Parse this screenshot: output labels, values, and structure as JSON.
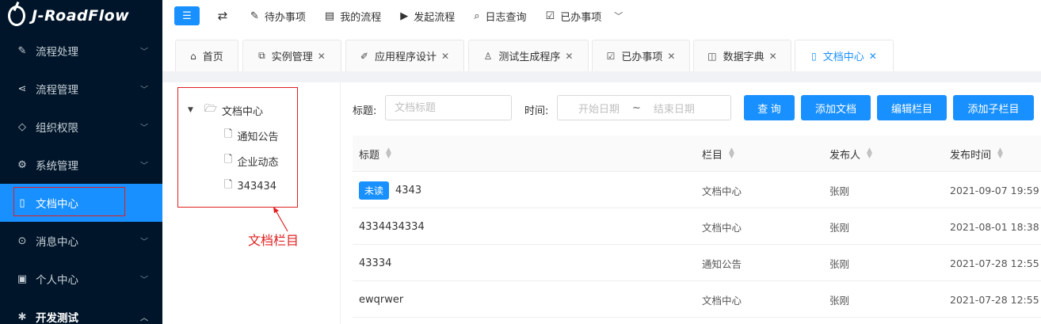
{
  "app": {
    "logo_text": "J-RoadFlow"
  },
  "sidebar": {
    "items": [
      {
        "label": "流程处理",
        "icon": "edit-icon",
        "glyph": "✎"
      },
      {
        "label": "流程管理",
        "icon": "share-icon",
        "glyph": "⋖"
      },
      {
        "label": "组织权限",
        "icon": "tag-icon",
        "glyph": "◇"
      },
      {
        "label": "系统管理",
        "icon": "gear-icon",
        "glyph": "⚙"
      },
      {
        "label": "文档中心",
        "icon": "document-icon",
        "glyph": "▯"
      },
      {
        "label": "消息中心",
        "icon": "chat-icon",
        "glyph": "⊙"
      },
      {
        "label": "个人中心",
        "icon": "id-card-icon",
        "glyph": "▣"
      },
      {
        "label": "开发测试",
        "icon": "code-icon",
        "glyph": "✱"
      }
    ]
  },
  "topbar": {
    "links": [
      {
        "label": "待办事项",
        "glyph": "✎"
      },
      {
        "label": "我的流程",
        "glyph": "▤"
      },
      {
        "label": "发起流程",
        "glyph": "▶"
      },
      {
        "label": "日志查询",
        "glyph": "⌕"
      },
      {
        "label": "已办事项",
        "glyph": "☑"
      }
    ]
  },
  "tabs": [
    {
      "label": "首页",
      "glyph": "⌂",
      "closable": false
    },
    {
      "label": "实例管理",
      "glyph": "⧉",
      "closable": true
    },
    {
      "label": "应用程序设计",
      "glyph": "✐",
      "closable": true
    },
    {
      "label": "测试生成程序",
      "glyph": "♙",
      "closable": true
    },
    {
      "label": "已办事项",
      "glyph": "☑",
      "closable": true
    },
    {
      "label": "数据字典",
      "glyph": "◫",
      "closable": true
    },
    {
      "label": "文档中心",
      "glyph": "▯",
      "closable": true
    }
  ],
  "tree": {
    "root": "文档中心",
    "children": [
      "通知公告",
      "企业动态",
      "343434"
    ]
  },
  "annotation": {
    "label": "文档栏目"
  },
  "search": {
    "title_label": "标题:",
    "title_placeholder": "文档标题",
    "time_label": "时间:",
    "start_placeholder": "开始日期",
    "range_sep": "~",
    "end_placeholder": "结束日期",
    "buttons": [
      "查 询",
      "添加文档",
      "编辑栏目",
      "添加子栏目"
    ]
  },
  "table": {
    "columns": [
      "标题",
      "栏目",
      "发布人",
      "发布时间"
    ],
    "rows": [
      {
        "badge": "未读",
        "title": "4343",
        "column": "文档中心",
        "author": "张刚",
        "time": "2021-09-07 19:59"
      },
      {
        "badge": "",
        "title": "4334434334",
        "column": "文档中心",
        "author": "张刚",
        "time": "2021-08-01 18:38"
      },
      {
        "badge": "",
        "title": "43334",
        "column": "通知公告",
        "author": "张刚",
        "time": "2021-07-28 12:55"
      },
      {
        "badge": "",
        "title": "ewqrwer",
        "column": "文档中心",
        "author": "张刚",
        "time": "2021-07-28 12:55"
      }
    ]
  },
  "colors": {
    "primary": "#1890ff",
    "sidebar_bg": "#001529",
    "annotation": "#e02020"
  }
}
